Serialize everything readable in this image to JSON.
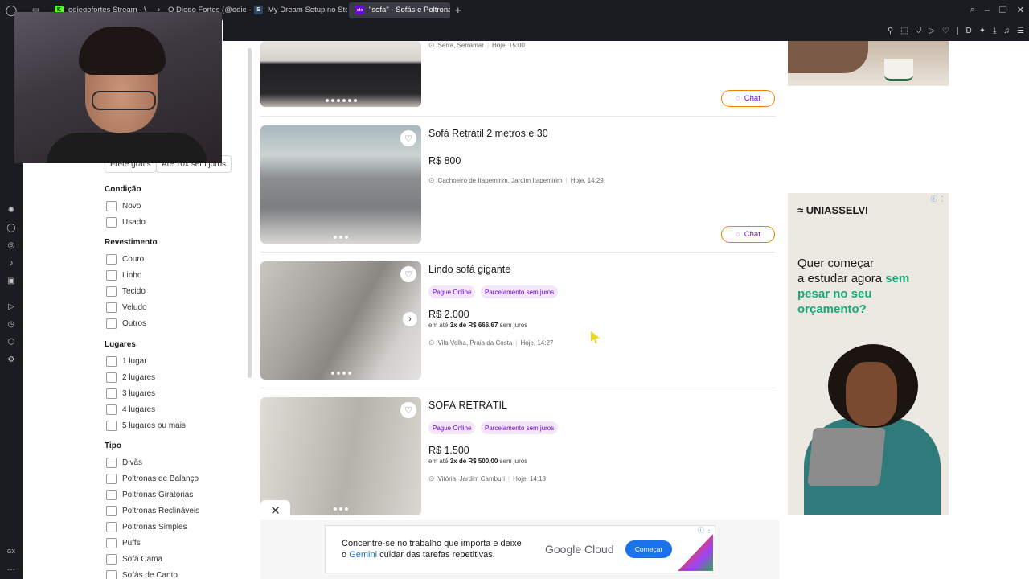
{
  "browser": {
    "tabs": [
      {
        "label": "odiegofortes Stream - Wat",
        "fav": "K",
        "fav_color": "#53fc18",
        "active": false
      },
      {
        "label": "O Diego Fortes (@odiegof",
        "fav": "♪",
        "fav_color": "#111111",
        "active": false
      },
      {
        "label": "My Dream Setup no Steam",
        "fav": "S",
        "fav_color": "#2a475e",
        "active": false
      },
      {
        "label": "\"sofa\" - Sofás e Poltronas",
        "fav": "olx",
        "fav_color": "#6e0ad6",
        "active": true
      }
    ],
    "new_tab": "+"
  },
  "filters": {
    "chips": [
      "Frete grátis",
      "Até 10x sem juros"
    ],
    "condicao": {
      "title": "Condição",
      "options": [
        "Novo",
        "Usado"
      ]
    },
    "revestimento": {
      "title": "Revestimento",
      "options": [
        "Couro",
        "Linho",
        "Tecido",
        "Veludo",
        "Outros"
      ]
    },
    "lugares": {
      "title": "Lugares",
      "options": [
        "1 lugar",
        "2 lugares",
        "3 lugares",
        "4 lugares",
        "5 lugares ou mais"
      ]
    },
    "tipo": {
      "title": "Tipo",
      "options": [
        "Divãs",
        "Poltronas de Balanço",
        "Poltronas Giratórias",
        "Poltronas Reclináveis",
        "Poltronas Simples",
        "Puffs",
        "Sofá Cama",
        "Sofás de Canto"
      ]
    }
  },
  "listings": [
    {
      "title": "",
      "price": "",
      "location": "Serra, Serramar",
      "date": "Hoje, 15:00",
      "chat": "Chat"
    },
    {
      "title": "Sofá Retrátil 2 metros e 30",
      "price": "R$ 800",
      "location": "Cachoeiro de Itapemirim, Jardim Itapemirim",
      "date": "Hoje, 14:29",
      "chat": "Chat"
    },
    {
      "title": "Lindo sofá gigante",
      "badges": [
        "Pague Online",
        "Parcelamento sem juros"
      ],
      "price": "R$ 2.000",
      "inst_pre": "em até",
      "inst_val": "3x de R$ 666,67",
      "inst_post": "sem juros",
      "location": "Vila Velha, Praia da Costa",
      "date": "Hoje, 14:27"
    },
    {
      "title": "SOFÁ RETRÁTIL",
      "badges": [
        "Pague Online",
        "Parcelamento sem juros"
      ],
      "price": "R$ 1.500",
      "inst_pre": "em até",
      "inst_val": "3x de R$ 500,00",
      "inst_post": "sem juros",
      "location": "Vitória, Jardim Camburi",
      "date": "Hoje, 14:18"
    }
  ],
  "ads": {
    "uniasselvi": {
      "brand": "UNIASSELVI",
      "line1": "Quer começar",
      "line2_pre": "a estudar agora ",
      "line2_hl": "sem",
      "line3_hl": "pesar no seu",
      "line4_hl": "orçamento?"
    },
    "google": {
      "text_a": "Concentre-se no trabalho que importa e deixe",
      "text_b_pre": "o ",
      "text_b_gem": "Gemini",
      "text_b_post": " cuidar das tarefas repetitivas.",
      "brand": "Google Cloud",
      "cta": "Começar"
    },
    "close": "✕"
  },
  "colors": {
    "accent": "#6e0ad6",
    "orange": "#f28000",
    "badge_bg": "#f3e6f6"
  }
}
